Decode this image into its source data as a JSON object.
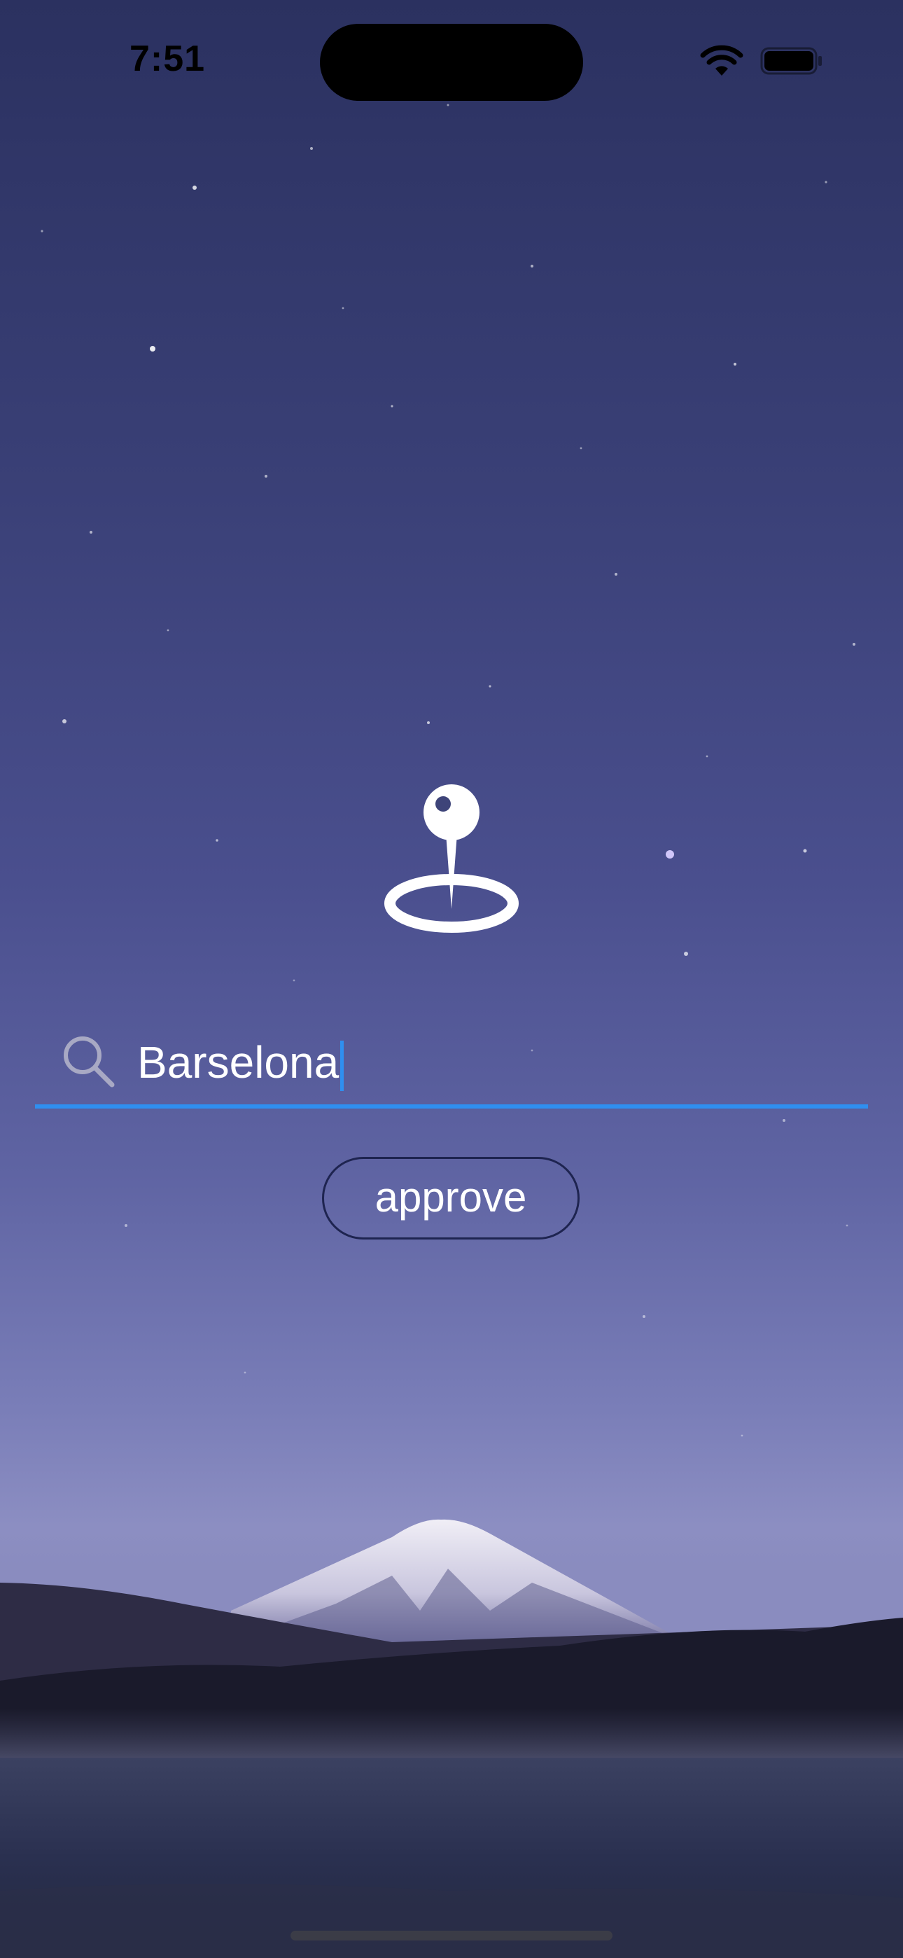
{
  "status_bar": {
    "time": "7:51"
  },
  "main": {
    "icon": "location-pin-icon",
    "search": {
      "icon": "search-icon",
      "value": "Barselona",
      "accent_color": "#2f8ff0"
    },
    "approve_button": {
      "label": "approve"
    }
  },
  "background": {
    "description_colors": [
      "#2b3160",
      "#5f64a3",
      "#8c8ec2"
    ]
  }
}
